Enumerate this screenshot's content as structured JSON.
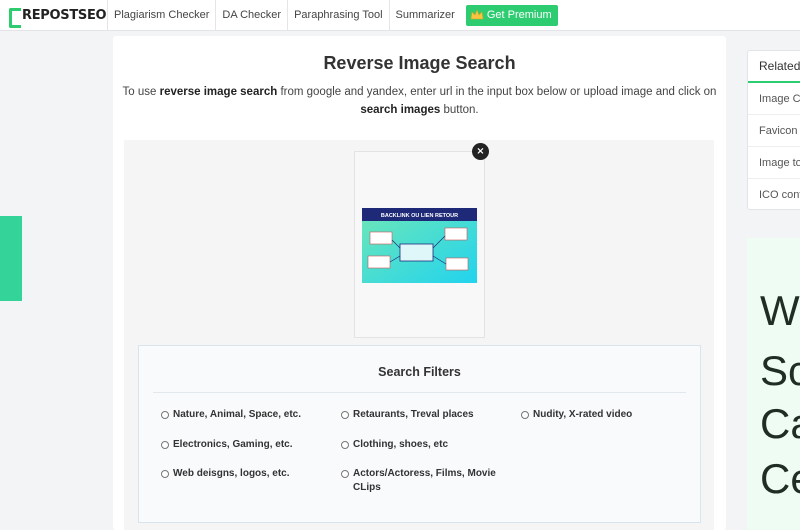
{
  "brand": {
    "logo_text": "REPOSTSEO",
    "accent": "#2ecc71"
  },
  "nav": {
    "items": [
      "Plagiarism Checker",
      "DA Checker",
      "Paraphrasing Tool",
      "Summarizer"
    ],
    "premium_label": "Get Premium"
  },
  "main": {
    "title": "Reverse Image Search",
    "desc_pre": "To use ",
    "desc_bold1": "reverse image search",
    "desc_mid": " from google and yandex, enter url in the input box below or upload image and click on ",
    "desc_bold2": "search images",
    "desc_post": " button.",
    "close_icon": "×",
    "thumbnail": {
      "heading": "BACKLINK OU LIEN RETOUR"
    }
  },
  "filters": {
    "title": "Search Filters",
    "options": [
      "Nature, Animal, Space, etc.",
      "Retaurants, Treval places",
      "Nudity, X-rated video",
      "Electronics, Gaming, etc.",
      "Clothing, shoes, etc",
      "Web deisgns, logos, etc.",
      "Actors/Actoress, Films, Movie CLips"
    ]
  },
  "sidebar": {
    "heading": "Related",
    "items": [
      "Image C",
      "Favicon",
      "Image to",
      "ICO conv"
    ]
  },
  "ad": {
    "lines": [
      "W",
      "Sc",
      "Ca",
      "Ce"
    ]
  }
}
